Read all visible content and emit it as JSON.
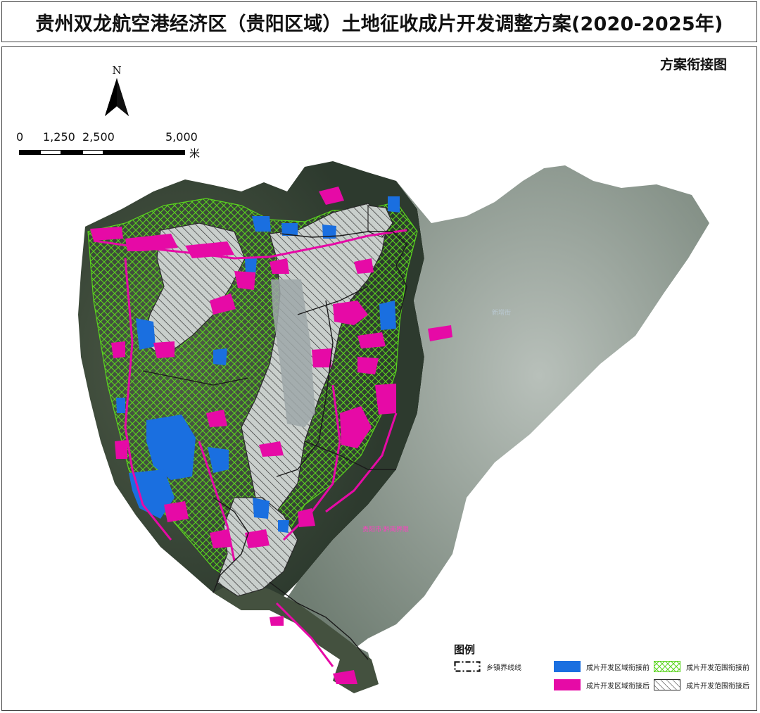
{
  "header": {
    "title": "贵州双龙航空港经济区（贵阳区域）土地征收成片开发调整方案(2020-2025年)"
  },
  "map": {
    "subtitle": "方案衔接图",
    "north_label": "N",
    "scale_labels": [
      "0",
      "1,250",
      "2,500",
      "5,000"
    ],
    "scale_unit": "米",
    "place_labels": [
      {
        "text": "新增街",
        "color": "#b9c8d0"
      },
      {
        "text": "贵阳市·黔南界限",
        "color": "#ff3ec4"
      }
    ],
    "colors": {
      "region_dark": "#3e4a3c",
      "region_light": "#9aa59c",
      "development_before": "#1a6fe0",
      "development_after": "#e60aa6",
      "scope_before_hatch": "#58d020",
      "scope_after_hatch": "#2b2b2b",
      "boundary_line": "#1a1a1a"
    }
  },
  "legend": {
    "title": "图例",
    "items": [
      {
        "label": "乡镇界线线",
        "type": "dash-box"
      },
      {
        "label": "成片开发区域衔接前",
        "type": "blue"
      },
      {
        "label": "成片开发范围衔接前",
        "type": "green-cross"
      },
      {
        "label": "成片开发区域衔接后",
        "type": "magenta"
      },
      {
        "label": "成片开发范围衔接后",
        "type": "black-hatch"
      }
    ]
  }
}
